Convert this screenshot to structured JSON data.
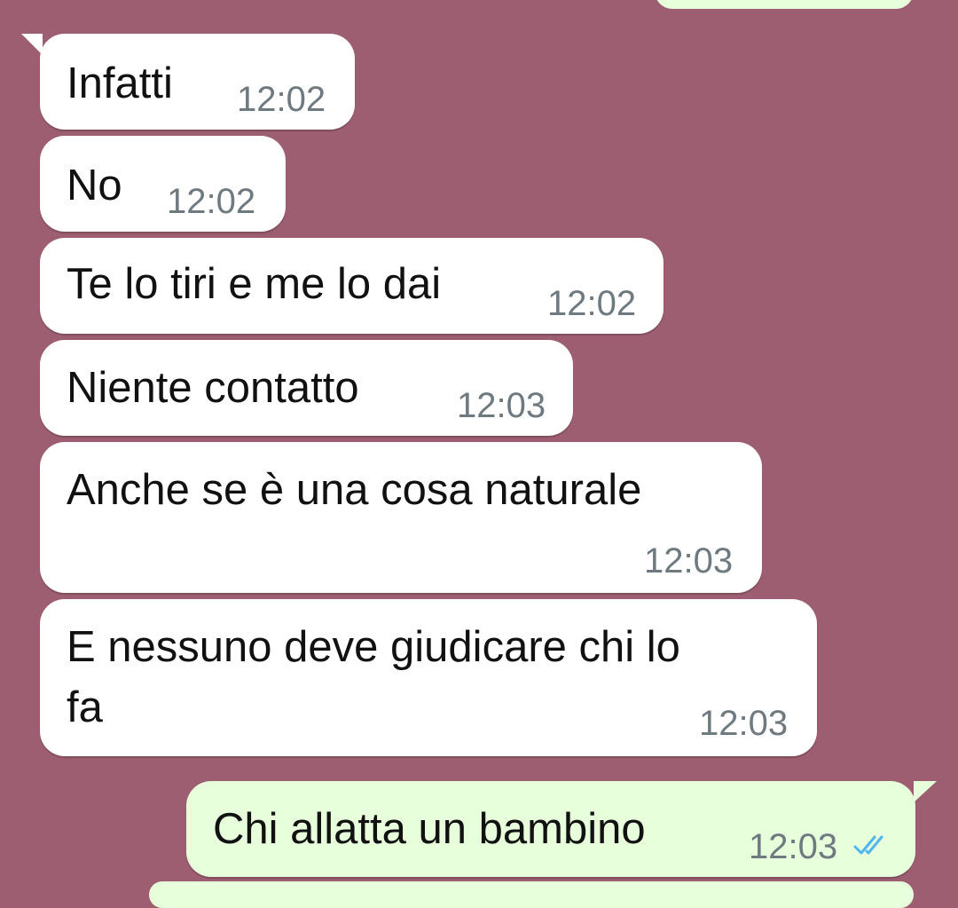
{
  "colors": {
    "chat_background": "#9c5e70",
    "incoming_bubble": "#ffffff",
    "outgoing_bubble": "#e7ffdb",
    "timestamp": "#6f7a80",
    "read_ticks": "#4fb6ec"
  },
  "messages": [
    {
      "direction": "incoming",
      "text": "Infatti",
      "time": "12:02"
    },
    {
      "direction": "incoming",
      "text": "No",
      "time": "12:02"
    },
    {
      "direction": "incoming",
      "text": "Te lo tiri e me lo dai",
      "time": "12:02"
    },
    {
      "direction": "incoming",
      "text": "Niente contatto",
      "time": "12:03"
    },
    {
      "direction": "incoming",
      "text": "Anche se è una cosa naturale",
      "time": "12:03"
    },
    {
      "direction": "incoming",
      "text_line1": "E nessuno deve giudicare chi lo",
      "text_line2": "fa",
      "time": "12:03"
    },
    {
      "direction": "outgoing",
      "text": "Chi allatta un bambino",
      "time": "12:03",
      "status_icon": "double-check-read-icon"
    }
  ]
}
